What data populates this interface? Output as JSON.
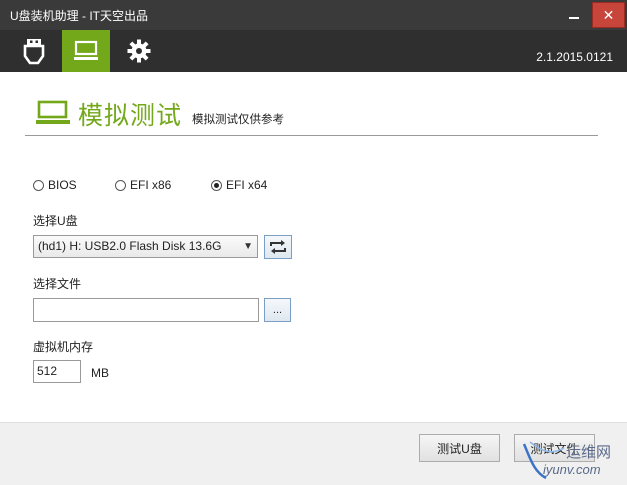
{
  "window": {
    "title": "U盘装机助理 - IT天空出品",
    "close_label": "✕",
    "version": "2.1.2015.0121"
  },
  "toolbar": {
    "items": [
      {
        "icon": "usb-drive-icon"
      },
      {
        "icon": "virtual-machine-icon",
        "active": true
      },
      {
        "icon": "gear-icon"
      }
    ]
  },
  "header": {
    "title": "模拟测试",
    "subtitle": "模拟测试仅供参考"
  },
  "boot_mode": {
    "options": [
      "BIOS",
      "EFI x86",
      "EFI x64"
    ],
    "selected": "EFI x64"
  },
  "disk": {
    "label": "选择U盘",
    "selected": "(hd1) H: USB2.0 Flash Disk 13.6G"
  },
  "file": {
    "label": "选择文件",
    "value": "",
    "browse_label": "..."
  },
  "memory": {
    "label": "虚拟机内存",
    "value": "512",
    "unit": "MB"
  },
  "actions": {
    "test_label": "测试U盘",
    "test_file_label": "测试文件"
  },
  "watermark": {
    "line1": "运维网",
    "line2": "iyunv.com"
  },
  "colors": {
    "accent": "#74a81b",
    "titlebar": "#3a3a3a",
    "toolbar": "#2f2f2f",
    "close": "#c7453a"
  }
}
